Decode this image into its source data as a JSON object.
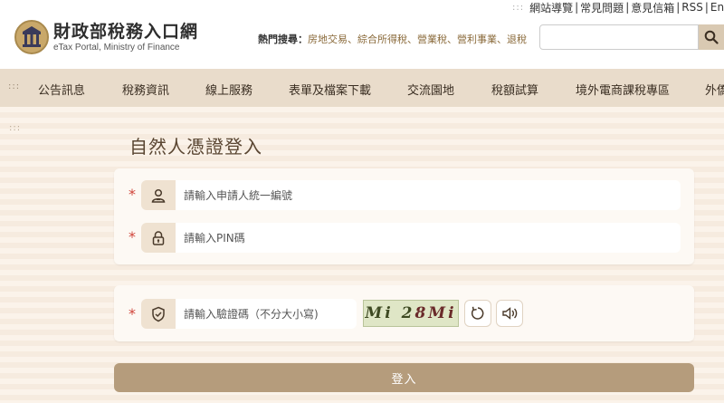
{
  "toplinks": {
    "items": [
      "網站導覽",
      "常見問題",
      "意見信箱",
      "RSS",
      "Eng"
    ]
  },
  "logo": {
    "title": "財政部稅務入口網",
    "subtitle": "eTax Portal, Ministry of Finance"
  },
  "hot_search": {
    "label": "熱門搜尋：",
    "items": "房地交易、綜合所得稅、營業稅、營利事業、退稅"
  },
  "search": {
    "placeholder": "",
    "icon": "search-icon"
  },
  "nav": {
    "items": [
      "公告訊息",
      "稅務資訊",
      "線上服務",
      "表單及檔案下載",
      "交流園地",
      "稅額試算",
      "境外電商課稅專區",
      "外僑"
    ]
  },
  "page": {
    "title": "自然人憑證登入"
  },
  "form": {
    "required_mark": "*",
    "id_placeholder": "請輸入申請人統一編號",
    "pin_placeholder": "請輸入PIN碼",
    "captcha_placeholder": "請輸入驗證碼（不分大小寫)",
    "captcha_text_a": "Mi 2",
    "captcha_text_b": "8Mi",
    "login_label": "登入"
  },
  "colors": {
    "accent": "#b59c7c",
    "nav_bg": "#e9dccb",
    "required": "#d0443a"
  }
}
